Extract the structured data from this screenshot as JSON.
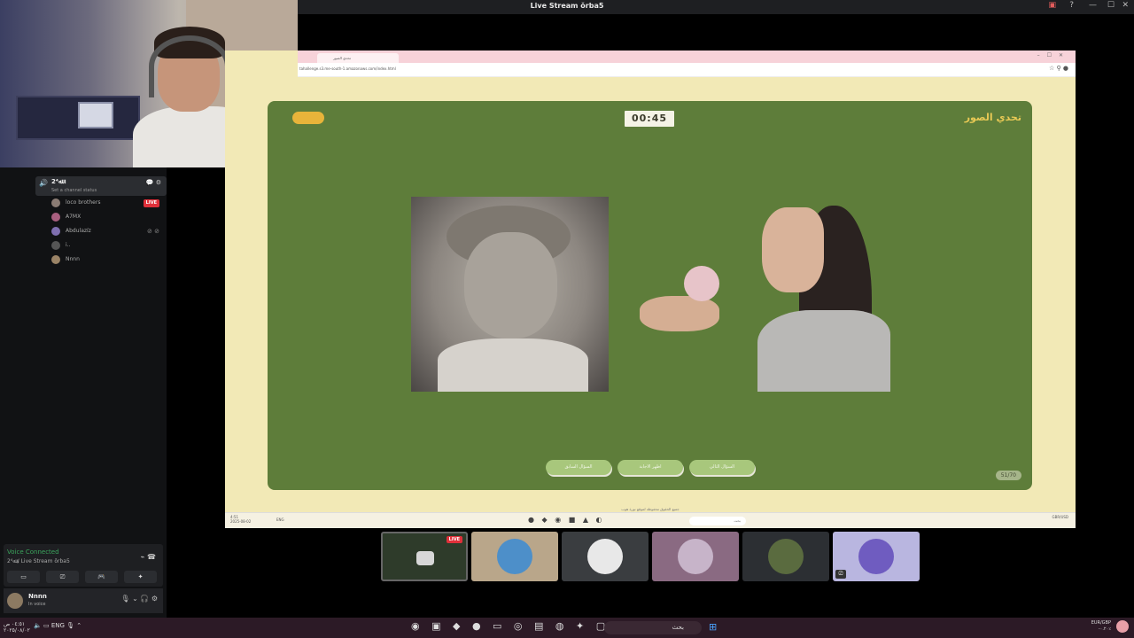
{
  "window": {
    "title": "Live Stream ŏrba5"
  },
  "sidebar": {
    "voice_channel": {
      "name": "2⁴ﷲ",
      "status": "Set a channel status"
    },
    "members": [
      {
        "name": "loco brothers",
        "live": "LIVE"
      },
      {
        "name": "A7MX"
      },
      {
        "name": "Abdulazíz"
      },
      {
        "name": "i.."
      },
      {
        "name": "Nnnn"
      }
    ]
  },
  "voice_panel": {
    "status": "Voice Connected",
    "channel": "2⁴ﷲ / Live Stream ŏrba5"
  },
  "user_panel": {
    "name": "Nnnn",
    "status": "In voice"
  },
  "stream": {
    "tab_title": "تحدي الصور",
    "url": "tahallenge.s3.me-south-1.amazonaws.com/index.html",
    "game": {
      "timer": "00:45",
      "title": "تحدي الصور",
      "buttons": [
        "السؤال السابق",
        "اظهر الاجابة",
        "السؤال التالي"
      ],
      "counter": "51/70"
    },
    "footer_note": "جميع الحقوق محفوظة لموقع نورة هوب",
    "taskbar": {
      "time": "4:51",
      "date": "2025-08-02",
      "lang": "ENG",
      "search": "بحث",
      "weather": "GBR/USD"
    }
  },
  "participants": {
    "live_label": "LIVE"
  },
  "taskbar": {
    "time": "٠٤:٥١ ص",
    "date": "٢٠٢٥/٠٨/٠٢",
    "lang": "ENG",
    "search": "بحث",
    "ticker": "EUR/GBP",
    "ticker_sub": "-٠.٢٠٪"
  }
}
